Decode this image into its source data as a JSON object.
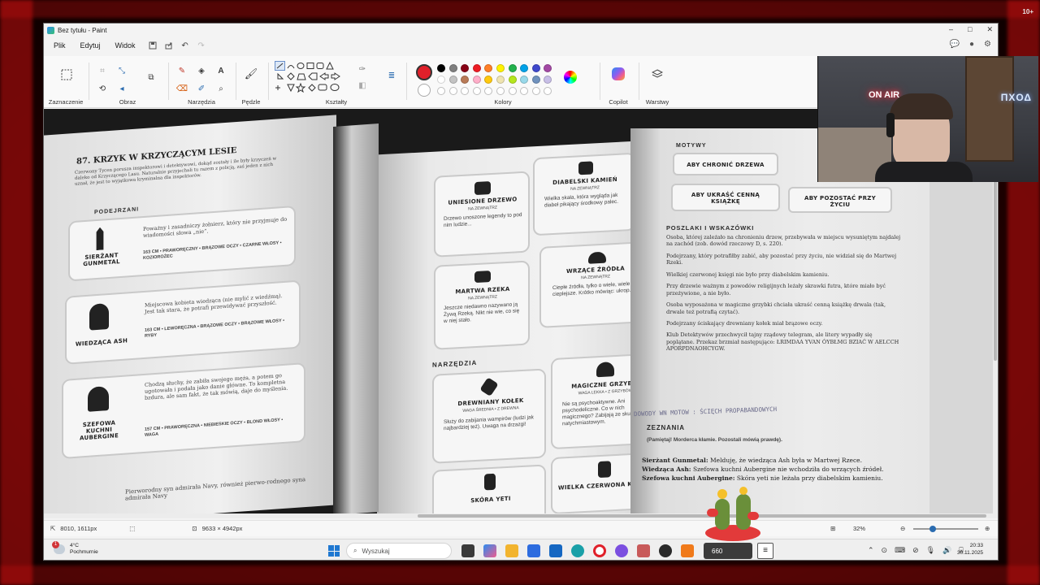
{
  "window": {
    "title": "Bez tytułu - Paint",
    "buttons": {
      "minimize": "–",
      "maximize": "□",
      "close": "✕"
    }
  },
  "menu": {
    "items": [
      "Plik",
      "Edytuj",
      "Widok"
    ],
    "quick_actions": [
      "save-icon",
      "share-icon",
      "undo-icon",
      "redo-icon"
    ]
  },
  "ribbon": {
    "groups": [
      "Zaznaczenie",
      "Obraz",
      "Narzędzia",
      "Pędzle",
      "Kształty",
      "Kolory",
      "Copilot",
      "Warstwy"
    ]
  },
  "colors": {
    "active": "#e0202a",
    "palette_row1": [
      "#000000",
      "#7f7f7f",
      "#880015",
      "#ed1c24",
      "#ff7f27",
      "#fff200",
      "#22b14c",
      "#00a2e8",
      "#3f48cc",
      "#a349a4"
    ],
    "palette_row2": [
      "#ffffff",
      "#c3c3c3",
      "#b97a57",
      "#ffaec9",
      "#ffc90e",
      "#efe4b0",
      "#b5e61d",
      "#99d9ea",
      "#7092be",
      "#c8bfe7"
    ],
    "palette_row3": [
      "#ffffff",
      "#ffffff",
      "#ffffff",
      "#ffffff",
      "#ffffff",
      "#ffffff",
      "#ffffff",
      "#ffffff",
      "#ffffff",
      "#ffffff"
    ]
  },
  "book": {
    "left_page": {
      "heading": "87. KRZYK W KRZYCZĄCYM LESIE",
      "intro": "Czerwony Tycen porusza inspektorowi i detektywowi, dokąd zostały i ile były krzyczeń w daleko od Krzyczącego Lasu. Naturalnie przyjechali tu razem z policją, zaś jeden z nich uznał, że jest to wyjątkowa kryminalna dla inspektorów.",
      "suspects_label": "PODEJRZANI",
      "suspects": [
        {
          "name": "SIERŻANT GUNMETAL",
          "desc": "Poważny i zasadniczy żołnierz, który nie przyjmuje do wiadomości słowa „nie”.",
          "stats": "163 CM • PRAWORĘCZNY • BRĄZOWE OCZY • CZARNE WŁOSY • KOZIOROŻEC"
        },
        {
          "name": "WIEDZĄCA ASH",
          "desc": "Miejscowa kobieta wiedząca (nie mylić z wiedźmą). Jest tak stara, że potrafi przewidywać przyszłość.",
          "stats": "163 CM • LEWORĘCZNA • BRĄZOWE OCZY • BRĄZOWE WŁOSY • RYBY"
        },
        {
          "name": "SZEFOWA KUCHNI AUBERGINE",
          "desc": "Chodzą słuchy, że zabiła swojego męża, a potem go ugotowała i podała jako danie główne. To kompletna bzdura, ale sam fakt, że tak mówią, daje do myślenia.",
          "stats": "157 CM • PRAWORĘCZNA • NIEBIESKIE OCZY • BLOND WŁOSY • WAGA"
        }
      ],
      "footer": "Pierworodny syn admirała Navy, również pierwo-rodnego syna admirała Navy"
    },
    "middle_page": {
      "locations": [
        {
          "name": "DIABELSKI KAMIEŃ",
          "sub": "NA ZEWNĄTRZ",
          "desc": "Wielka skała, która wygląda jak diabeł pikający środkowy palec."
        },
        {
          "name": "WRZĄCE ŹRÓDŁA",
          "sub": "NA ZEWNĄTRZ",
          "desc": "Ciepłe źródła, tylko o wiele, wiele cieplejsze. Krótko mówiąc: ukrop."
        },
        {
          "name": "MARTWA RZEKA",
          "sub": "NA ZEWNĄTRZ",
          "desc": "Jeszcze niedawno nazywano ją Żywą Rzeką. Nikt nie wie, co się w niej stało."
        },
        {
          "name": "UNIESIONE DRZEWO",
          "sub": "NA ZEWNĄTRZ",
          "desc": "Drzewo unoszone legendy to pod nim ludzie..."
        }
      ],
      "tools_label": "NARZĘDZIA",
      "tools": [
        {
          "name": "DREWNIANY KOŁEK",
          "sub": "WAGA ŚREDNIA • Z DREWNA",
          "desc": "Służy do zabijania wampirów (ludzi jak najbardziej też). Uwaga na drzazgi!"
        },
        {
          "name": "MAGICZNE GRZYBKI",
          "sub": "WAGA LEKKA • Z GRZYBÓW",
          "desc": "Nie są psychoaktywne. Ani psychodeliczne. Co w nich magicznego? Zabijają ze skutkiem natychmiastowym."
        },
        {
          "name": "SKÓRA YETI",
          "sub": "",
          "desc": ""
        },
        {
          "name": "WIELKA CZERWONA KSIĘGA",
          "sub": "",
          "desc": ""
        }
      ]
    },
    "right_page": {
      "motives_label": "MOTYWY",
      "motives": [
        "ABY CHRONIĆ DRZEWA",
        "ABY UKRAŚĆ CENNĄ KSIĄŻKĘ",
        "ABY POZOSTAĆ PRZY ŻYCIU"
      ],
      "clues_label": "POSZLAKI I WSKAZÓWKI",
      "clues": [
        "Osoba, której zależało na chronieniu drzew, przebywała w miejscu wysuniętym najdalej na zachód (zob. dowód rzeczowy D, s. 220).",
        "Podejrzany, który potrafiłby zabić, aby pozostać przy życiu, nie widział się do Martwej Rzeki.",
        "Wielkiej czerwonej księgi nie było przy diabelskim kamieniu.",
        "Przy drzewie ważnym z powodów religijnych leżały skrawki futra, które miało być przeżywione, a nie było.",
        "Osoba wyposażona w magiczne grzybki chciała ukraść cenną książkę drwala (tak, drwale też potrafią czytać).",
        "Podejrzany ściskający drewniany kołek miał brązowe oczy.",
        "Klub Detektywów przechwycił tajny rządowy telegram, ale litery wypadły się poplątane. Przekaz brzmiał następująco: ŁRIMDAA YVAN ÓYBŁMG BZIAĆ W AELCCH APORPDNAOHCYGW."
      ],
      "handwriting": "DOWODY WN MOTOW : ŚCIĘCH PROPABANDOWYCH",
      "testimony_label": "ZEZNANIA",
      "testimony_note": "(Pamiętaj! Morderca kłamie. Pozostali mówią prawdę).",
      "testimonies": [
        {
          "who": "Sierżant Gunmetal:",
          "text": "Melduję, że wiedząca Ash była w Martwej Rzece."
        },
        {
          "who": "Wiedząca Ash:",
          "text": "Szefowa kuchni Aubergine nie wchodziła do wrzących źródeł."
        },
        {
          "who": "Szefowa kuchni Aubergine:",
          "text": "Skóra yeti nie leżała przy diabelskim kamieniu."
        }
      ]
    }
  },
  "status": {
    "cursor": "8010, 1611px",
    "canvas_size": "9633 × 4942px",
    "zoom": "32%",
    "zoom_fraction": 0.3
  },
  "taskbar": {
    "weather_temp": "4°C",
    "weather_desc": "Pochmurnie",
    "search_placeholder": "Wyszukaj",
    "stream_count": "660",
    "time": "20:33",
    "date": "30.11.2025",
    "notification_count": "1"
  },
  "webcam": {
    "on_air": "ON AIR",
    "ps_logo": "ΠΧΟΔ"
  },
  "corner": "10+"
}
